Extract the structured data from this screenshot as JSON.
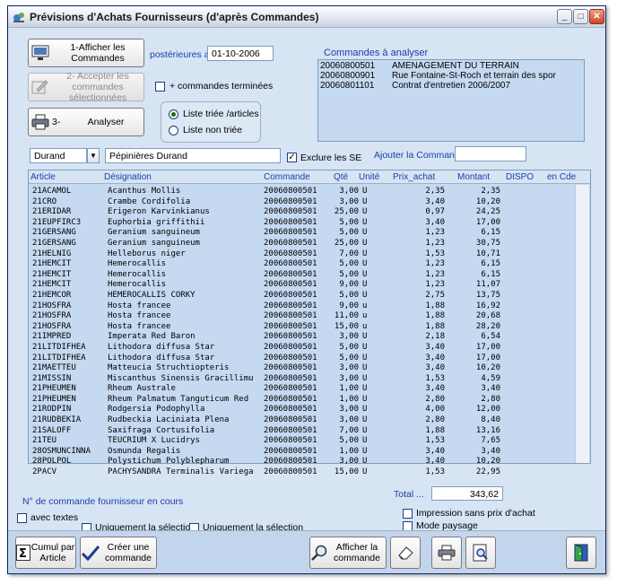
{
  "window": {
    "title": "Prévisions d'Achats Fournisseurs (d'après Commandes)",
    "minimize": "_",
    "maximize": "□",
    "close": "✕"
  },
  "actions": {
    "show_orders": "1-Afficher les Commandes",
    "accept_orders": "2- Accepter les commandes sélectionnées",
    "analyze_num": "3-",
    "analyze": "Analyser"
  },
  "filters": {
    "after_label": "postérieures au",
    "after_date": "01-10-2006",
    "finished_orders": "+ commandes terminées",
    "finished_orders_checked": false,
    "sort_sorted": "Liste triée /articles",
    "sort_unsorted": "Liste non triée",
    "sort_selected": "sorted",
    "exclude_se": "Exclure les SE",
    "exclude_se_checked": true,
    "add_order_label": "Ajouter la Commande",
    "add_order_value": ""
  },
  "supplier": {
    "code": "Durand",
    "name": "Pépinières Durand"
  },
  "orders_panel": {
    "title": "Commandes à analyser",
    "rows": [
      {
        "num": "20060800501",
        "desc": "AMENAGEMENT DU TERRAIN"
      },
      {
        "num": "20060800901",
        "desc": "Rue Fontaine-St-Roch et terrain des spor"
      },
      {
        "num": "20060801101",
        "desc": "Contrat d'entretien 2006/2007"
      }
    ]
  },
  "grid": {
    "headers": {
      "article": "Article",
      "designation": "Désignation",
      "commande": "Commande",
      "qte": "Qté",
      "unite": "Unité",
      "prix": "Prix_achat",
      "montant": "Montant",
      "dispo": "DISPO",
      "encde": "en Cde"
    },
    "rows": [
      {
        "article": "21ACAMOL",
        "designation": "Acanthus Mollis",
        "commande": "20060800501",
        "qte": "3,00",
        "unite": "U",
        "prix": "2,35",
        "montant": "2,35"
      },
      {
        "article": "21CRO",
        "designation": "Crambe Cordifolia",
        "commande": "20060800501",
        "qte": "3,00",
        "unite": "U",
        "prix": "3,40",
        "montant": "10,20"
      },
      {
        "article": "21ERIDAR",
        "designation": "Erigeron Karvinkianus",
        "commande": "20060800501",
        "qte": "25,00",
        "unite": "U",
        "prix": "0,97",
        "montant": "24,25"
      },
      {
        "article": "21EUPFIRC3",
        "designation": "Euphorbia griffithii",
        "commande": "20060800501",
        "qte": "5,00",
        "unite": "U",
        "prix": "3,40",
        "montant": "17,00"
      },
      {
        "article": "21GERSANG",
        "designation": "Geranium  sanguineum",
        "commande": "20060800501",
        "qte": "5,00",
        "unite": "U",
        "prix": "1,23",
        "montant": "6,15"
      },
      {
        "article": "21GERSANG",
        "designation": "Geranium  sanguineum",
        "commande": "20060800501",
        "qte": "25,00",
        "unite": "U",
        "prix": "1,23",
        "montant": "30,75"
      },
      {
        "article": "21HELNIG",
        "designation": "Helleborus niger",
        "commande": "20060800501",
        "qte": "7,00",
        "unite": "U",
        "prix": "1,53",
        "montant": "10,71"
      },
      {
        "article": "21HEMCIT",
        "designation": "Hemerocallis",
        "commande": "20060800501",
        "qte": "5,00",
        "unite": "U",
        "prix": "1,23",
        "montant": "6,15"
      },
      {
        "article": "21HEMCIT",
        "designation": "Hemerocallis",
        "commande": "20060800501",
        "qte": "5,00",
        "unite": "U",
        "prix": "1,23",
        "montant": "6,15"
      },
      {
        "article": "21HEMCIT",
        "designation": "Hemerocallis",
        "commande": "20060800501",
        "qte": "9,00",
        "unite": "U",
        "prix": "1,23",
        "montant": "11,07"
      },
      {
        "article": "21HEMCOR",
        "designation": "HEMEROCALLIS  CORKY",
        "commande": "20060800501",
        "qte": "5,00",
        "unite": "U",
        "prix": "2,75",
        "montant": "13,75"
      },
      {
        "article": "21HOSFRA",
        "designation": "Hosta francee",
        "commande": "20060800501",
        "qte": "9,00",
        "unite": "u",
        "prix": "1,88",
        "montant": "16,92"
      },
      {
        "article": "21HOSFRA",
        "designation": "Hosta francee",
        "commande": "20060800501",
        "qte": "11,00",
        "unite": "u",
        "prix": "1,88",
        "montant": "20,68"
      },
      {
        "article": "21HOSFRA",
        "designation": "Hosta francee",
        "commande": "20060800501",
        "qte": "15,00",
        "unite": "u",
        "prix": "1,88",
        "montant": "28,20"
      },
      {
        "article": "21IMPRED",
        "designation": "Imperata Red Baron",
        "commande": "20060800501",
        "qte": "3,00",
        "unite": "U",
        "prix": "2,18",
        "montant": "6,54"
      },
      {
        "article": "21LITDIFHEA",
        "designation": "Lithodora diffusa Star",
        "commande": "20060800501",
        "qte": "5,00",
        "unite": "U",
        "prix": "3,40",
        "montant": "17,00"
      },
      {
        "article": "21LITDIFHEA",
        "designation": "Lithodora diffusa Star",
        "commande": "20060800501",
        "qte": "5,00",
        "unite": "U",
        "prix": "3,40",
        "montant": "17,00"
      },
      {
        "article": "21MAETTEU",
        "designation": "Matteucia Struchtiopteris",
        "commande": "20060800501",
        "qte": "3,00",
        "unite": "U",
        "prix": "3,40",
        "montant": "10,20"
      },
      {
        "article": "21MISSIN",
        "designation": "Miscanthus Sinensis Gracillimu",
        "commande": "20060800501",
        "qte": "3,00",
        "unite": "U",
        "prix": "1,53",
        "montant": "4,59"
      },
      {
        "article": "21PHEUMEN",
        "designation": "Rheum Australe",
        "commande": "20060800501",
        "qte": "1,00",
        "unite": "U",
        "prix": "3,40",
        "montant": "3,40"
      },
      {
        "article": "21PHEUMEN",
        "designation": "Rheum Palmatum Tanguticum Red",
        "commande": "20060800501",
        "qte": "1,00",
        "unite": "U",
        "prix": "2,80",
        "montant": "2,80"
      },
      {
        "article": "21RODPIN",
        "designation": "Rodgersia Podophylla",
        "commande": "20060800501",
        "qte": "3,00",
        "unite": "U",
        "prix": "4,00",
        "montant": "12,00"
      },
      {
        "article": "21RUDBEKIA",
        "designation": "Rudbeckia Laciniata Plena",
        "commande": "20060800501",
        "qte": "3,00",
        "unite": "U",
        "prix": "2,80",
        "montant": "8,40"
      },
      {
        "article": "21SALOFF",
        "designation": "Saxifraga Cortusifolia",
        "commande": "20060800501",
        "qte": "7,00",
        "unite": "U",
        "prix": "1,88",
        "montant": "13,16"
      },
      {
        "article": "21TEU",
        "designation": "TEUCRIUM X Lucidrys",
        "commande": "20060800501",
        "qte": "5,00",
        "unite": "U",
        "prix": "1,53",
        "montant": "7,65"
      },
      {
        "article": "28OSMUNCINNA",
        "designation": "Osmunda Regalis",
        "commande": "20060800501",
        "qte": "1,00",
        "unite": "U",
        "prix": "3,40",
        "montant": "3,40"
      },
      {
        "article": "28POLPOL",
        "designation": "Polystichum Polyblepharum",
        "commande": "20060800501",
        "qte": "3,00",
        "unite": "U",
        "prix": "3,40",
        "montant": "10,20"
      },
      {
        "article": "2PACV",
        "designation": "PACHYSANDRA Terminalis Variega",
        "commande": "20060800501",
        "qte": "15,00",
        "unite": "U",
        "prix": "1,53",
        "montant": "22,95"
      }
    ]
  },
  "footer": {
    "order_num_label": "N° de commande fournisseur en cours",
    "total_label": "Total ...",
    "total_value": "343,62",
    "with_texts": "avec textes",
    "only_selection_1": "Uniquement la sélection",
    "only_selection_2": "Uniquement la sélection",
    "print_no_price": "Impression sans prix d'achat",
    "landscape": "Mode paysage"
  },
  "toolbar": {
    "cumul": "Cumul par Article",
    "create_order": "Créer une commande",
    "show_order": "Afficher la commande"
  },
  "colors": {
    "panel_bg": "#d6e4f4",
    "grid_bg": "#c5d9f1",
    "label_blue": "#1c3faa",
    "toolbar_bg": "#c2d5ec"
  }
}
